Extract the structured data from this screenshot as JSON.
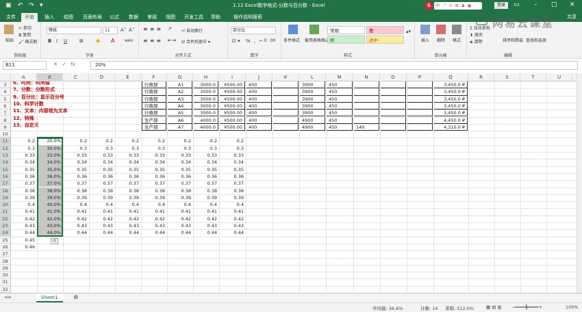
{
  "titlebar": {
    "title": "1.12 Excel数字格式-分数与百分数  -  Excel",
    "login": "登录",
    "brand_s": "S",
    "brand_tools": "中 ,° ⊙ ⊞ ♟ ▣"
  },
  "tabs": [
    "文件",
    "开始",
    "插入",
    "绘图",
    "页面布局",
    "公式",
    "数据",
    "审阅",
    "视图",
    "开发工具",
    "帮助",
    "操作说明搜索"
  ],
  "share": "共享",
  "watermark": "网易云课堂",
  "ribbon": {
    "paste": "粘贴",
    "cut": "剪切",
    "copy": "复制",
    "format_painter": "格式刷",
    "clipboard": "剪贴板",
    "font_name": "等线",
    "font_size": "11",
    "font": "字体",
    "wrap": "自动换行",
    "merge": "合并后居中",
    "alignment": "对齐方式",
    "number_format": "百分比",
    "number": "数字",
    "cond_format": "条件格式",
    "table_format": "套用表格格式",
    "styles": "样式",
    "style_normal": "常规",
    "style_bad": "差",
    "style_good": "好",
    "style_neutral": "适中",
    "insert": "插入",
    "delete": "删除",
    "format": "格式",
    "cells": "单元格",
    "autosum": "自动求和",
    "fill": "填充",
    "clear": "清除",
    "sort": "排序和筛选",
    "find": "查找和选择",
    "editing": "编辑"
  },
  "formula_bar": {
    "name_box": "B11",
    "value": "20%"
  },
  "columns": [
    "A",
    "B",
    "C",
    "D",
    "E",
    "F",
    "G",
    "H",
    "I",
    "J",
    "K",
    "L",
    "M",
    "N",
    "O",
    "P",
    "Q",
    "R",
    "S",
    "T",
    "U"
  ],
  "rows": [
    "3",
    "4",
    "5",
    "6",
    "7",
    "8",
    "9",
    "10",
    "11",
    "12",
    "13",
    "14",
    "15",
    "16",
    "17",
    "18",
    "19",
    "20",
    "21",
    "22",
    "23",
    "24",
    "25",
    "26",
    "27",
    "28",
    "29",
    "30",
    "31",
    "32"
  ],
  "notes": [
    "6、时间：时间值",
    "7、分数：分数形式",
    "9、百分比：显示百分号",
    "10、科学计数",
    "11、文本：内容视为文本",
    "12、特殊",
    "13、自定义"
  ],
  "dept_table": [
    [
      "行政部",
      "A1",
      "3000.0",
      "¥500.00",
      "400",
      "3900",
      "450",
      "",
      "3,450.0 ₽"
    ],
    [
      "行政部",
      "A2",
      "3000.0",
      "¥500.00",
      "400",
      "3900",
      "450",
      "",
      "3,450.0 ₽"
    ],
    [
      "行政部",
      "A3",
      "3000.0",
      "¥500.00",
      "400",
      "3900",
      "450",
      "",
      "3,450.0 ₽"
    ],
    [
      "行政部",
      "A4",
      "3000.0",
      "¥500.00",
      "400",
      "3900",
      "450",
      "",
      "3,450.0 ₽"
    ],
    [
      "行政部",
      "A5",
      "3000.0",
      "¥500.00",
      "400",
      "3900",
      "450",
      "",
      "3,450.0 ₽"
    ],
    [
      "生产部",
      "A6",
      "4000.0",
      "¥500.00",
      "400",
      "4900",
      "450",
      "",
      "4,450.0 ₽"
    ],
    [
      "生产部",
      "A7",
      "4000.0",
      "¥500.00",
      "400",
      "4900",
      "450",
      "140",
      "4,310.0 ₽"
    ]
  ],
  "num_rows": [
    [
      "0.2",
      "20.0%",
      "0.2",
      "0.2",
      "0.2",
      "0.2",
      "0.2",
      "0.2",
      "0.2"
    ],
    [
      "0.3",
      "30.0%",
      "0.3",
      "0.3",
      "0.3",
      "0.3",
      "0.3",
      "0.3",
      "0.3"
    ],
    [
      "0.33",
      "33.0%",
      "0.33",
      "0.33",
      "0.33",
      "0.33",
      "0.33",
      "0.33",
      "0.33"
    ],
    [
      "0.34",
      "34.0%",
      "0.34",
      "0.34",
      "0.34",
      "0.34",
      "0.34",
      "0.34",
      "0.34"
    ],
    [
      "0.35",
      "35.0%",
      "0.35",
      "0.35",
      "0.35",
      "0.35",
      "0.35",
      "0.35",
      "0.35"
    ],
    [
      "0.36",
      "36.0%",
      "0.36",
      "0.36",
      "0.36",
      "0.36",
      "0.36",
      "0.36",
      "0.36"
    ],
    [
      "0.37",
      "37.0%",
      "0.37",
      "0.37",
      "0.37",
      "0.37",
      "0.37",
      "0.37",
      "0.37"
    ],
    [
      "0.38",
      "38.0%",
      "0.38",
      "0.38",
      "0.38",
      "0.38",
      "0.38",
      "0.38",
      "0.38"
    ],
    [
      "0.39",
      "39.0%",
      "0.39",
      "0.39",
      "0.39",
      "0.39",
      "0.39",
      "0.39",
      "0.39"
    ],
    [
      "0.4",
      "40.0%",
      "0.4",
      "0.4",
      "0.4",
      "0.4",
      "0.4",
      "0.4",
      "0.4"
    ],
    [
      "0.41",
      "41.0%",
      "0.41",
      "0.41",
      "0.41",
      "0.41",
      "0.41",
      "0.41",
      "0.41"
    ],
    [
      "0.42",
      "42.0%",
      "0.42",
      "0.42",
      "0.42",
      "0.42",
      "0.42",
      "0.42",
      "0.42"
    ],
    [
      "0.43",
      "43.0%",
      "0.43",
      "0.43",
      "0.43",
      "0.43",
      "0.43",
      "0.43",
      "0.43"
    ],
    [
      "0.44",
      "44.0%",
      "0.44",
      "0.44",
      "0.44",
      "0.44",
      "0.44",
      "0.44",
      "0.44"
    ],
    [
      "0.45",
      "",
      "",
      "",
      "",
      "",
      "",
      "",
      ""
    ],
    [
      "0.46",
      "",
      "",
      "",
      "",
      "",
      "",
      "",
      ""
    ]
  ],
  "sheet_tab": "Sheet1",
  "statusbar": {
    "average": "平均值: 36.6%",
    "count": "计数: 14",
    "sum": "求和: 512.0%",
    "zoom": "100%"
  }
}
